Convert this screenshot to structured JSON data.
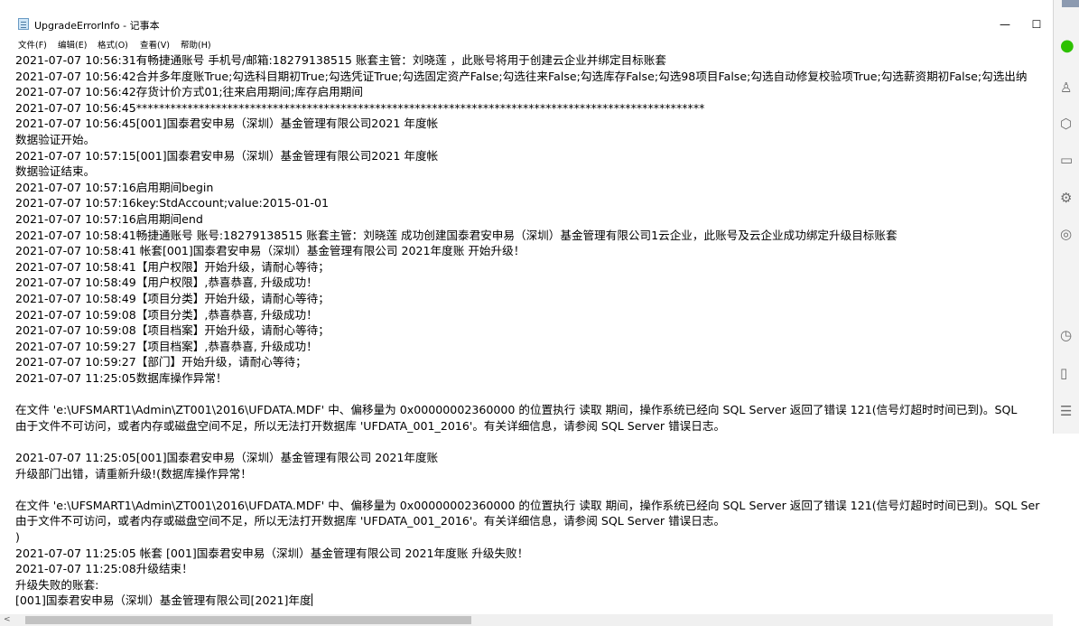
{
  "window": {
    "title": "UpgradeErrorInfo - 记事本",
    "minimize_label": "—",
    "maximize_label": "☐"
  },
  "menu": [
    {
      "label": "文件(F)"
    },
    {
      "label": "编辑(E)"
    },
    {
      "label": "格式(O)"
    },
    {
      "label": "查看(V)"
    },
    {
      "label": "帮助(H)"
    }
  ],
  "content": {
    "lines": [
      "2021-07-07 10:56:31有畅捷通账号  手机号/邮箱:18279138515  账套主管：刘晓莲 ，此账号将用于创建云企业并绑定目标账套",
      "2021-07-07 10:56:42合并多年度账True;勾选科目期初True;勾选凭证True;勾选固定资产False;勾选往来False;勾选库存False;勾选98项目False;勾选自动修复校验项True;勾选薪资期初False;勾选出纳",
      "2021-07-07 10:56:42存货计价方式01;往来启用期间;库存启用期间",
      "2021-07-07 10:56:45****************************************************************************************************",
      "2021-07-07 10:56:45[001]国泰君安申易（深圳）基金管理有限公司2021 年度帐",
      "数据验证开始。",
      "2021-07-07 10:57:15[001]国泰君安申易（深圳）基金管理有限公司2021 年度帐",
      "数据验证结束。",
      "2021-07-07 10:57:16启用期间begin",
      "2021-07-07 10:57:16key:StdAccount;value:2015-01-01",
      "2021-07-07 10:57:16启用期间end",
      "2021-07-07 10:58:41畅捷通账号  账号:18279138515  账套主管：刘晓莲 成功创建国泰君安申易（深圳）基金管理有限公司1云企业，此账号及云企业成功绑定升级目标账套",
      "2021-07-07 10:58:41 帐套[001]国泰君安申易（深圳）基金管理有限公司 2021年度账 开始升级！",
      "2021-07-07 10:58:41【用户权限】开始升级，请耐心等待；",
      "2021-07-07 10:58:49【用户权限】,恭喜恭喜, 升级成功！",
      "2021-07-07 10:58:49【项目分类】开始升级，请耐心等待；",
      "2021-07-07 10:59:08【项目分类】,恭喜恭喜, 升级成功！",
      "2021-07-07 10:59:08【项目档案】开始升级，请耐心等待；",
      "2021-07-07 10:59:27【项目档案】,恭喜恭喜, 升级成功！",
      "2021-07-07 10:59:27【部门】开始升级，请耐心等待；",
      "2021-07-07 11:25:05数据库操作异常！",
      "",
      "在文件 'e:\\UFSMART1\\Admin\\ZT001\\2016\\UFDATA.MDF' 中、偏移量为 0x00000002360000 的位置执行 读取 期间，操作系统已经向 SQL Server 返回了错误 121(信号灯超时时间已到)。SQL",
      "由于文件不可访问，或者内存或磁盘空间不足，所以无法打开数据库 'UFDATA_001_2016'。有关详细信息，请参阅 SQL Server 错误日志。",
      "",
      "2021-07-07 11:25:05[001]国泰君安申易（深圳）基金管理有限公司 2021年度账",
      "升级部门出错，请重新升级!(数据库操作异常！",
      "",
      "在文件 'e:\\UFSMART1\\Admin\\ZT001\\2016\\UFDATA.MDF' 中、偏移量为 0x00000002360000 的位置执行 读取 期间，操作系统已经向 SQL Server 返回了错误 121(信号灯超时时间已到)。SQL Ser",
      "由于文件不可访问，或者内存或磁盘空间不足，所以无法打开数据库 'UFDATA_001_2016'。有关详细信息，请参阅 SQL Server 错误日志。",
      ")",
      "2021-07-07 11:25:05 帐套 [001]国泰君安申易（深圳）基金管理有限公司 2021年度账 升级失败！",
      "2021-07-07 11:25:08升级结束！",
      "升级失败的账套:",
      "[001]国泰君安申易（深圳）基金管理有限公司[2021]年度"
    ]
  },
  "scrollbar": {
    "left_arrow": "<"
  },
  "side_panel": {
    "icons": [
      {
        "name": "wechat-icon",
        "glyph": "●"
      },
      {
        "name": "user-icon",
        "glyph": "♙"
      },
      {
        "name": "cube-icon",
        "glyph": "⬡"
      },
      {
        "name": "folder-icon",
        "glyph": "▭"
      },
      {
        "name": "gear-icon",
        "glyph": "⚙"
      },
      {
        "name": "aperture-icon",
        "glyph": "◎"
      },
      {
        "name": "clock-icon",
        "glyph": "◷"
      },
      {
        "name": "phone-icon",
        "glyph": "▯"
      },
      {
        "name": "menu-icon",
        "glyph": "☰"
      }
    ]
  }
}
